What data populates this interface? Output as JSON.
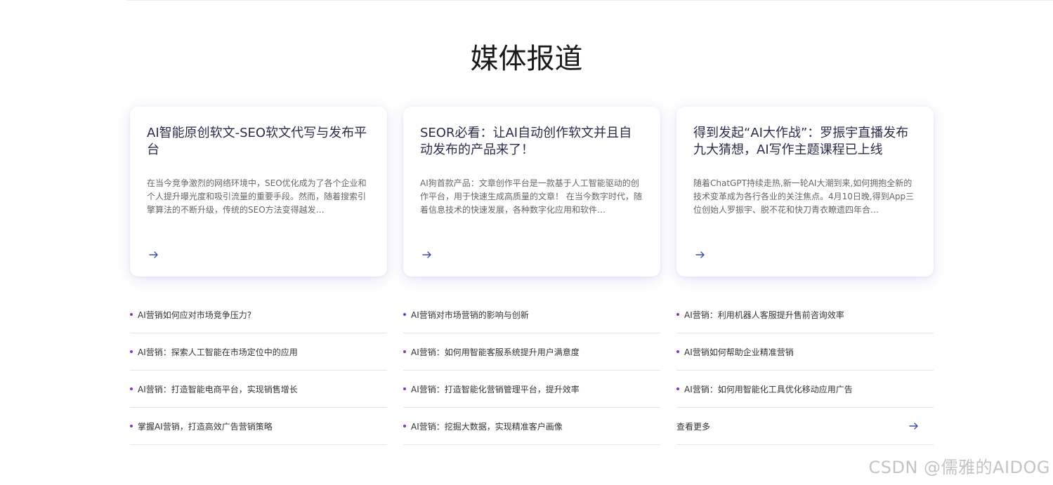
{
  "section": {
    "title": "媒体报道"
  },
  "cards": [
    {
      "title": "AI智能原创软文-SEO软文代写与发布平台",
      "description": "在当今竞争激烈的网络环境中，SEO优化成为了各个企业和个人提升曝光度和吸引流量的重要手段。然而，随着搜索引擎算法的不断升级，传统的SEO方法变得越发…",
      "arrow_icon": "arrow-right-icon"
    },
    {
      "title": "SEOR必看：让AI自动创作软文并且自动发布的产品来了！",
      "description": "AI狗首款产品：文章创作平台是一款基于人工智能驱动的创作平台，用于快速生成高质量的文章！ 在当今数字时代，随着信息技术的快速发展，各种数字化应用和软件…",
      "arrow_icon": "arrow-right-icon"
    },
    {
      "title": "得到发起“AI大作战”：罗振宇直播发布九大猜想，AI写作主题课程已上线",
      "description": "随着ChatGPT持续走热,新一轮AI大潮到来,如何拥抱全新的技术变革成为各行各业的关注焦点。4月10日晚,得到App三位创始人罗振宇、脱不花和快刀青衣瞭遗四年合…",
      "arrow_icon": "arrow-right-icon"
    }
  ],
  "lists": [
    {
      "items": [
        "AI营销如何应对市场竞争压力?",
        "AI营销：探索人工智能在市场定位中的应用",
        "AI营销：打造智能电商平台，实现销售增长",
        "掌握AI营销，打造高效广告营销策略"
      ]
    },
    {
      "items": [
        "AI营销对市场营销的影响与创新",
        "AI营销：如何用智能客服系统提升用户满意度",
        "AI营销：打造智能化营销管理平台，提升效率",
        "AI营销：挖掘大数据，实现精准客户画像"
      ]
    },
    {
      "items": [
        "AI营销：利用机器人客服提升售前咨询效率",
        "AI营销如何帮助企业精准营销",
        "AI营销：如何用智能化工具优化移动应用广告"
      ],
      "more_label": "查看更多"
    }
  ],
  "watermark": "CSDN @儒雅的AIDOG",
  "colors": {
    "accent": "#3a4fb0",
    "bullet": "#8b2fd0",
    "title": "#2a2d4a"
  }
}
